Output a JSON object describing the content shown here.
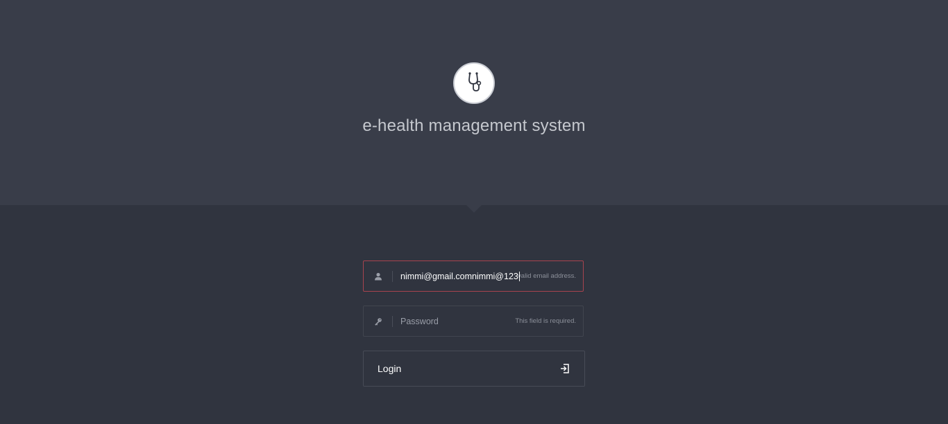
{
  "app": {
    "title": "e-health management system",
    "logo_icon": "stethoscope-icon"
  },
  "form": {
    "email": {
      "value": "nimmi@gmail.comnimmi@123",
      "hint": "valid email address.",
      "icon": "user-icon",
      "state": "error"
    },
    "password": {
      "placeholder": "Password",
      "hint": "This field is required.",
      "icon": "key-icon"
    },
    "login_button": {
      "label": "Login",
      "icon": "sign-in-icon"
    }
  },
  "colors": {
    "header_bg": "#393d49",
    "page_bg": "#30343f",
    "error_border": "#a8434e"
  }
}
